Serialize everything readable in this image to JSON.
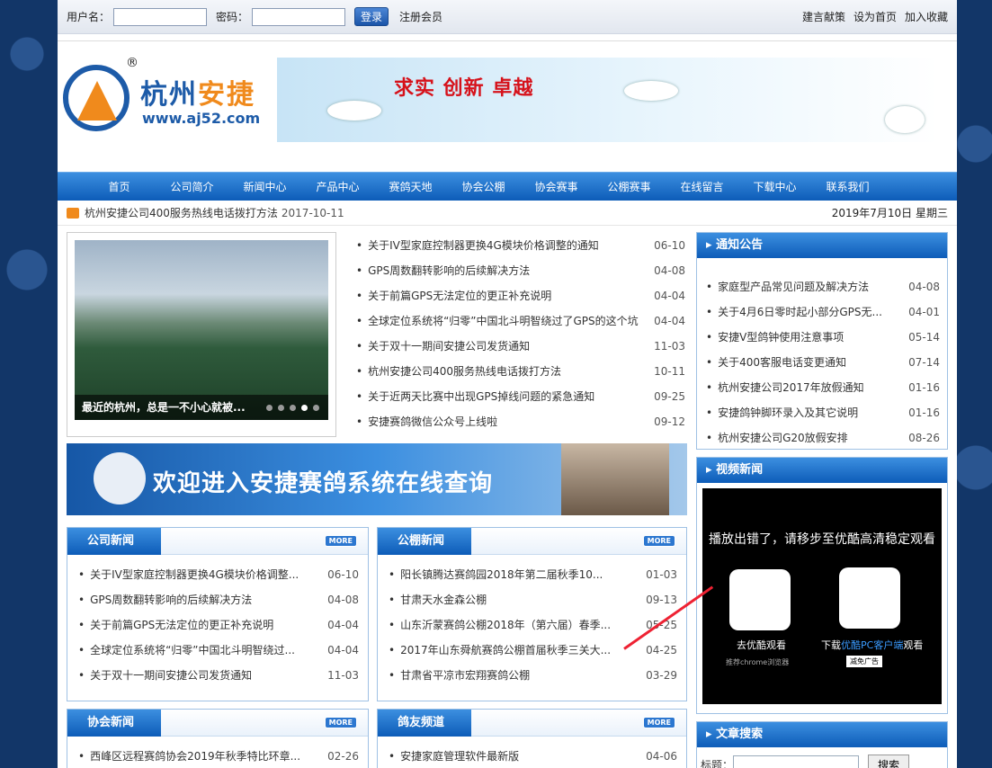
{
  "topbar": {
    "user_label": "用户名：",
    "pass_label": "密码：",
    "login": "登录",
    "register": "注册会员",
    "links": [
      "建言献策",
      "设为首页",
      "加入收藏"
    ]
  },
  "banner": {
    "reg": "®",
    "brand_a": "杭州",
    "brand_b": "安捷",
    "url": "www.aj52.com",
    "slogan": "求实  创新  卓越"
  },
  "nav": [
    "首页",
    "公司简介",
    "新闻中心",
    "产品中心",
    "赛鸽天地",
    "协会公棚",
    "协会赛事",
    "公棚赛事",
    "在线留言",
    "下载中心",
    "联系我们"
  ],
  "notice": {
    "text": "杭州安捷公司400服务热线电话拨打方法",
    "date": "2017-10-11",
    "today": "2019年7月10日 星期三"
  },
  "photo": {
    "caption": "最近的杭州，总是一不小心就被..."
  },
  "main_news": [
    {
      "t": "关于IV型家庭控制器更换4G模块价格调整的通知",
      "d": "06-10"
    },
    {
      "t": "GPS周数翻转影响的后续解决方法",
      "d": "04-08"
    },
    {
      "t": "关于前篇GPS无法定位的更正补充说明",
      "d": "04-04"
    },
    {
      "t": "全球定位系统将“归零”中国北斗明智绕过了GPS的这个坑",
      "d": "04-04"
    },
    {
      "t": "关于双十一期间安捷公司发货通知",
      "d": "11-03"
    },
    {
      "t": "杭州安捷公司400服务热线电话拨打方法",
      "d": "10-11"
    },
    {
      "t": "关于近两天比赛中出现GPS掉线问题的紧急通知",
      "d": "09-25"
    },
    {
      "t": "安捷赛鸽微信公众号上线啦",
      "d": "09-12"
    }
  ],
  "welcome": "欢迎进入安捷赛鸽系统在线查询",
  "notices": {
    "title": "通知公告",
    "items": [
      {
        "t": "家庭型产品常见问题及解决方法",
        "d": "04-08"
      },
      {
        "t": "关于4月6日零时起小部分GPS无...",
        "d": "04-01"
      },
      {
        "t": "安捷V型鸽钟使用注意事项",
        "d": "05-14"
      },
      {
        "t": "关于400客服电话变更通知",
        "d": "07-14"
      },
      {
        "t": "杭州安捷公司2017年放假通知",
        "d": "01-16"
      },
      {
        "t": "安捷鸽钟脚环录入及其它说明",
        "d": "01-16"
      },
      {
        "t": "杭州安捷公司G20放假安排",
        "d": "08-26"
      }
    ]
  },
  "company_news": {
    "title": "公司新闻",
    "more": "MORE",
    "items": [
      {
        "t": "关于IV型家庭控制器更换4G模块价格调整...",
        "d": "06-10"
      },
      {
        "t": "GPS周数翻转影响的后续解决方法",
        "d": "04-08"
      },
      {
        "t": "关于前篇GPS无法定位的更正补充说明",
        "d": "04-04"
      },
      {
        "t": "全球定位系统将“归零”中国北斗明智绕过...",
        "d": "04-04"
      },
      {
        "t": "关于双十一期间安捷公司发货通知",
        "d": "11-03"
      }
    ]
  },
  "loft_news": {
    "title": "公棚新闻",
    "more": "MORE",
    "items": [
      {
        "t": "阳长镇腾达赛鸽园2018年第二届秋季10...",
        "d": "01-03"
      },
      {
        "t": "甘肃天水金森公棚",
        "d": "09-13"
      },
      {
        "t": "山东沂蒙赛鸽公棚2018年（第六届）春季...",
        "d": "05-25"
      },
      {
        "t": "2017年山东舜航赛鸽公棚首届秋季三关大...",
        "d": "04-25"
      },
      {
        "t": "甘肃省平凉市宏翔赛鸽公棚",
        "d": "03-29"
      }
    ]
  },
  "assoc_news": {
    "title": "协会新闻",
    "more": "MORE",
    "items": [
      {
        "t": "西峰区远程赛鸽协会2019年秋季特比环章...",
        "d": "02-26"
      }
    ]
  },
  "friends": {
    "title": "鸽友频道",
    "more": "MORE",
    "items": [
      {
        "t": "安捷家庭管理软件最新版",
        "d": "04-06"
      }
    ]
  },
  "video": {
    "title": "视频新闻",
    "msg": "播放出错了，请移步至优酷高清稳定观看",
    "opt1": "去优酷观看",
    "opt1_sub": "推荐chrome浏览器",
    "opt2a": "下载",
    "opt2b": "优酷PC客户端",
    "opt2c": "观看",
    "ad": "减免广告"
  },
  "search": {
    "title": "文章搜索",
    "label": "标题：",
    "btn": "搜索"
  }
}
